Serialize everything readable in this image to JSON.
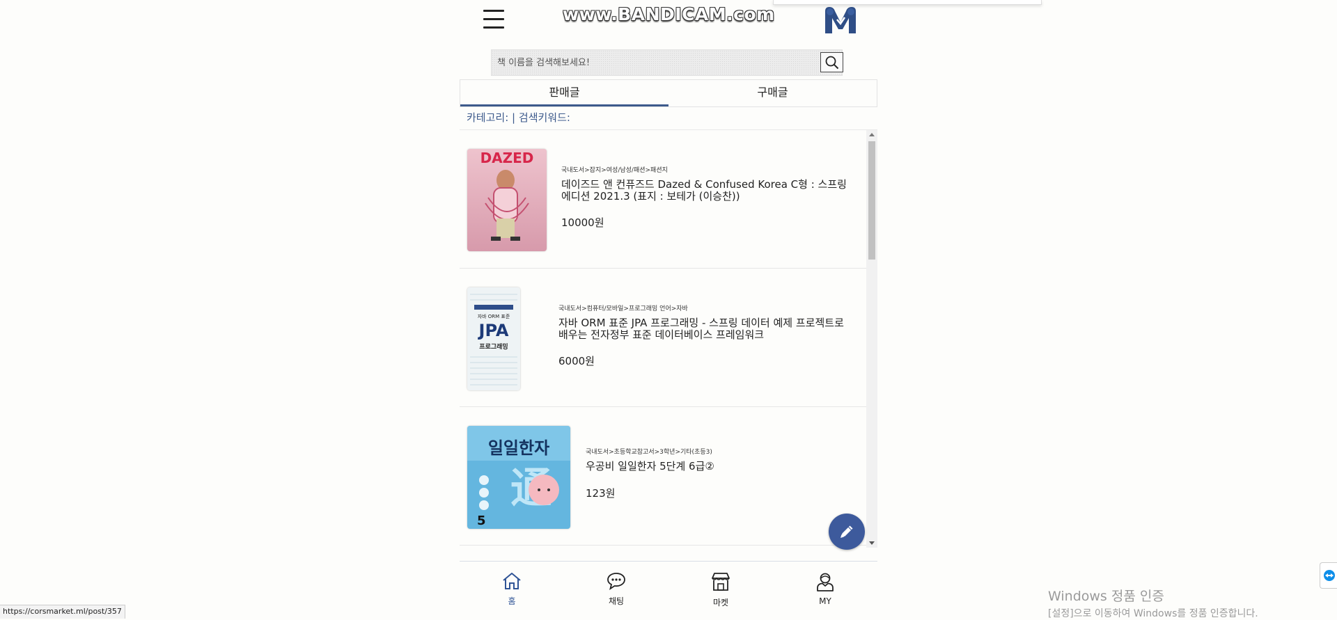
{
  "watermark": "www.BANDICAM.com",
  "search": {
    "placeholder": "책 이름을 검색해보세요!"
  },
  "tabs": [
    {
      "label": "판매글",
      "active": true
    },
    {
      "label": "구매글",
      "active": false
    }
  ],
  "filter": {
    "category_label": "카테고리:",
    "separator": "|",
    "keyword_label": "검색키워드:"
  },
  "posts": [
    {
      "category": "국내도서>잡지>여성/남성/패션>패션지",
      "title": "데이즈드 앤 컨퓨즈드 Dazed & Confused Korea C형 : 스프링 에디션 2021.3 (표지 : 보테가 (이승찬))",
      "price": "10000원",
      "cover_text": "DAZED"
    },
    {
      "category": "국내도서>컴퓨터/모바일>프로그래밍 언어>자바",
      "title": "자바 ORM 표준 JPA 프로그래밍 - 스프링 데이터 예제 프로젝트로 배우는 전자정부 표준 데이터베이스 프레임워크",
      "price": "6000원",
      "cover_text": "JPA",
      "cover_sub": "자바 ORM 표준",
      "cover_label": "프로그래밍"
    },
    {
      "category": "국내도서>초등학교참고서>3학년>기타(초등3)",
      "title": "우공비 일일한자 5단계 6급②",
      "price": "123원",
      "cover_text": "일일한자",
      "cover_num": "5"
    }
  ],
  "nav": [
    {
      "label": "홈",
      "icon": "home-icon",
      "active": true
    },
    {
      "label": "채팅",
      "icon": "chat-icon",
      "active": false
    },
    {
      "label": "마켓",
      "icon": "store-icon",
      "active": false
    },
    {
      "label": "MY",
      "icon": "user-icon",
      "active": false
    }
  ],
  "status_url": "https://corsmarket.ml/post/357",
  "windows_activation": {
    "title": "Windows 정품 인증",
    "subtitle": "[설정]으로 이동하여 Windows를 정품 인증합니다."
  },
  "colors": {
    "accent": "#3d5a8c",
    "fab": "#3d5a9c",
    "nav_active": "#2f5496"
  }
}
